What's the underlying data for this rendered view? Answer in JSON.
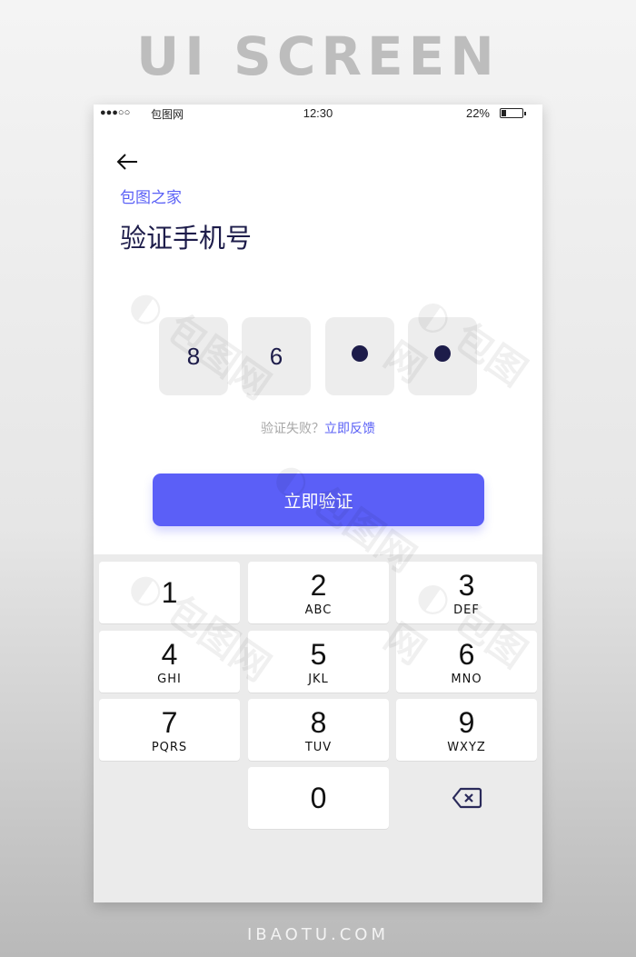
{
  "frame": {
    "header_title": "UI SCREEN",
    "footer_title": "IBAOTU.COM"
  },
  "status_bar": {
    "signal": "●●●○○",
    "carrier": "包图网",
    "time": "12:30",
    "battery_percent": "22%",
    "battery_level": 0.22
  },
  "page": {
    "subtitle": "包图之家",
    "title": "验证手机号"
  },
  "code": {
    "digits": [
      "8",
      "6",
      "",
      ""
    ],
    "masked": [
      false,
      false,
      true,
      true
    ]
  },
  "feedback": {
    "question": "验证失败？",
    "link": "立即反馈"
  },
  "verify_button": "立即验证",
  "keypad": {
    "keys": [
      {
        "digit": "1",
        "letters": ""
      },
      {
        "digit": "2",
        "letters": "ABC"
      },
      {
        "digit": "3",
        "letters": "DEF"
      },
      {
        "digit": "4",
        "letters": "GHI"
      },
      {
        "digit": "5",
        "letters": "JKL"
      },
      {
        "digit": "6",
        "letters": "MNO"
      },
      {
        "digit": "7",
        "letters": "PQRS"
      },
      {
        "digit": "8",
        "letters": "TUV"
      },
      {
        "digit": "9",
        "letters": "WXYZ"
      },
      {
        "digit": "0",
        "letters": ""
      }
    ]
  },
  "colors": {
    "accent": "#5b5ff7",
    "title_text": "#1d1c4a",
    "code_box": "#ededed",
    "keypad_bg": "#ebebeb"
  },
  "icons": {
    "back": "arrow-left-icon",
    "delete": "backspace-icon"
  }
}
